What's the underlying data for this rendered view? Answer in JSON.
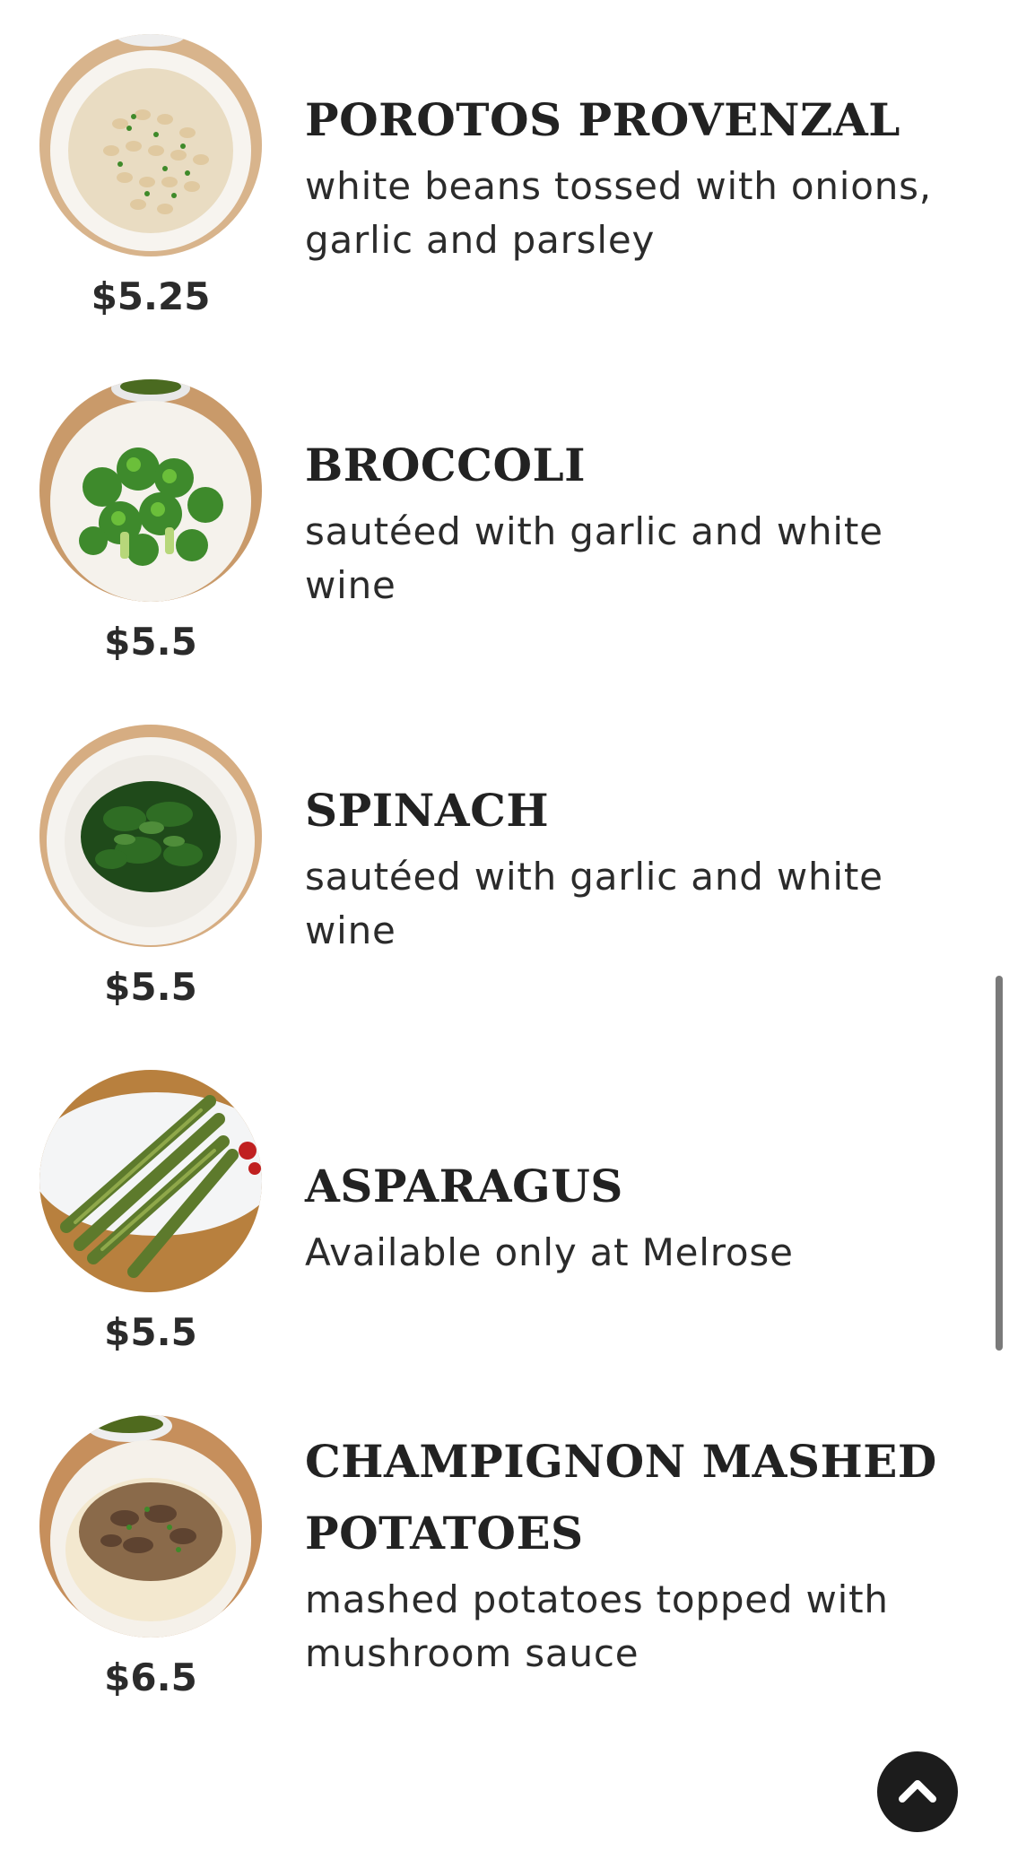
{
  "menu": {
    "items": [
      {
        "name": "POROTOS PROVENZAL",
        "description": "white beans tossed with onions, garlic and parsley",
        "price": "$5.25",
        "image_icon": "white-beans-dish-photo"
      },
      {
        "name": "BROCCOLI",
        "description": "sautéed with garlic and white wine",
        "price": "$5.5",
        "image_icon": "broccoli-dish-photo"
      },
      {
        "name": "SPINACH",
        "description": "sautéed with garlic and white wine",
        "price": "$5.5",
        "image_icon": "spinach-dish-photo"
      },
      {
        "name": "ASPARAGUS",
        "description": "Available only at Melrose",
        "price": "$5.5",
        "image_icon": "asparagus-dish-photo"
      },
      {
        "name": "CHAMPIGNON MASHED POTATOES",
        "description": "mashed potatoes topped with mushroom sauce",
        "price": "$6.5",
        "image_icon": "mashed-potatoes-dish-photo"
      }
    ]
  },
  "scroll_to_top": {
    "icon": "chevron-up-icon"
  },
  "colors": {
    "text": "#222222",
    "button_bg": "#1c1c1c",
    "scrollbar": "#7a7a7a"
  }
}
